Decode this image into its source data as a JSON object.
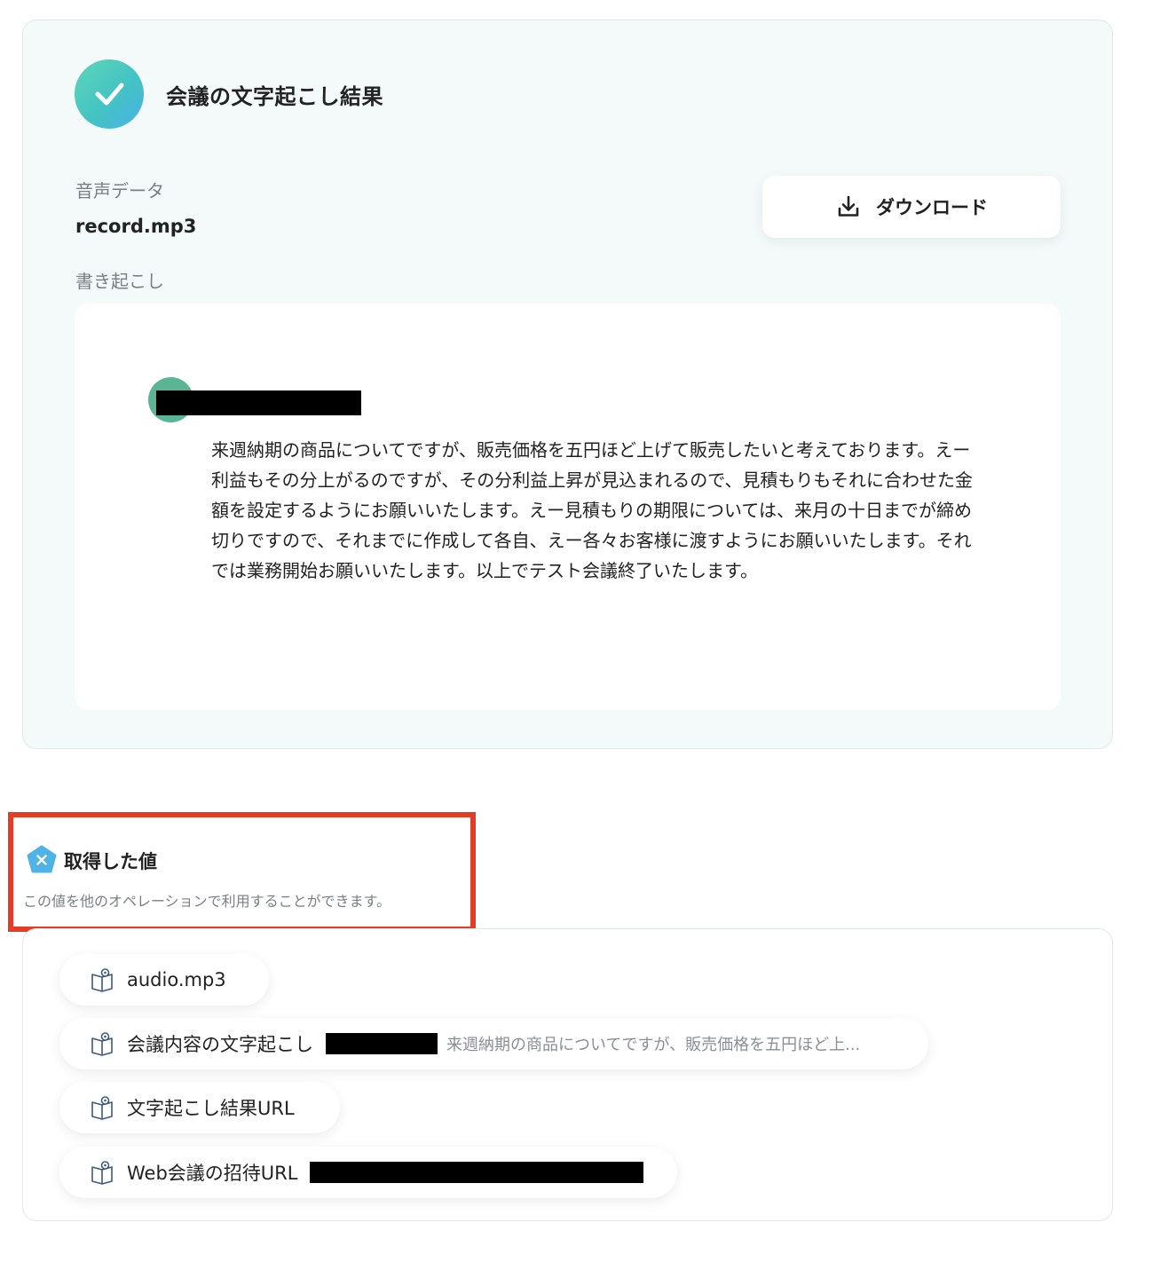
{
  "result": {
    "title": "会議の文字起こし結果",
    "audio_label": "音声データ",
    "audio_file": "record.mp3",
    "transcript_label": "書き起こし",
    "download_label": "ダウンロード",
    "transcript_text": "来週納期の商品についてですが、販売価格を五円ほど上げて販売したいと考えております。えー利益もその分上がるのですが、その分利益上昇が見込まれるので、見積もりもそれに合わせた金額を設定するようにお願いいたします。えー見積もりの期限については、来月の十日までが締め切りですので、それまでに作成して各自、えー各々お客様に渡すようにお願いいたします。それでは業務開始お願いいたします。以上でテスト会議終了いたします。"
  },
  "values_section": {
    "title": "取得した値",
    "description": "この値を他のオペレーションで利用することができます。",
    "items": [
      {
        "label": "audio.mp3",
        "preview": ""
      },
      {
        "label": "会議内容の文字起こし",
        "preview": "来週納期の商品についてですが、販売価格を五円ほど上..."
      },
      {
        "label": "文字起こし結果URL",
        "preview": ""
      },
      {
        "label": "Web会議の招待URL",
        "preview": ""
      }
    ]
  },
  "colors": {
    "accent_red": "#e33d26",
    "check_gradient_start": "#5ed6b8",
    "check_gradient_end": "#4ab1e6",
    "avatar_green": "#5ab594",
    "badge_blue": "#4fb3e8"
  },
  "icons": {
    "check": "check-icon",
    "download": "download-icon",
    "variable_badge": "x-variable-icon",
    "value_chip": "book-variable-icon"
  }
}
